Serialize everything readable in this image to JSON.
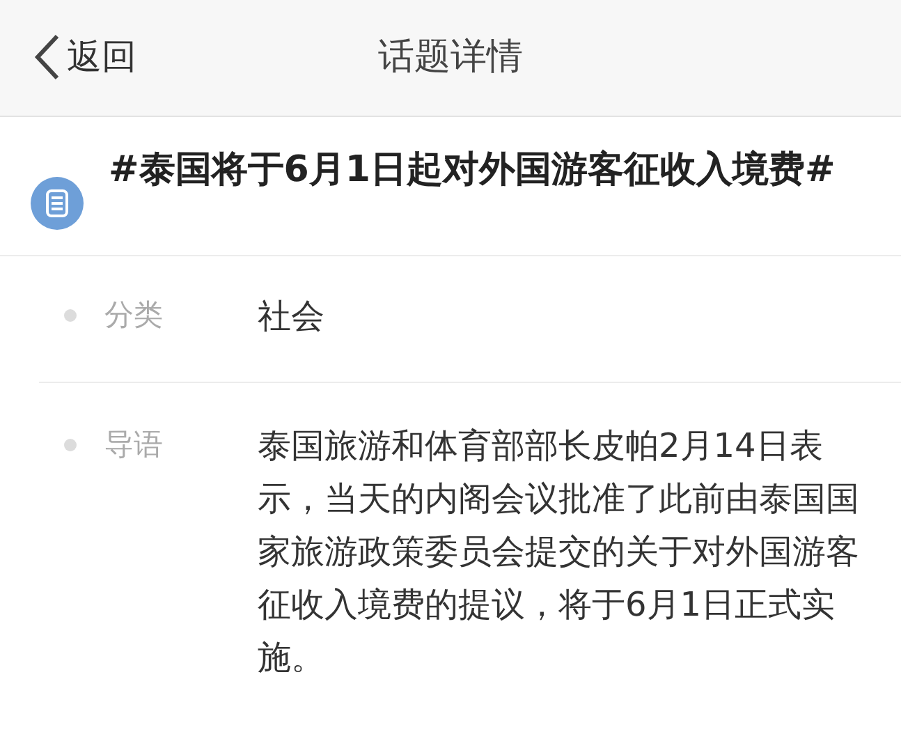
{
  "nav_bar": {
    "back": "返回",
    "title": "话题详情"
  },
  "topic": {
    "title": "#泰国将于6月1日起对外国游客征收入境费#"
  },
  "fields": [
    {
      "label": "分类",
      "value": "社会"
    },
    {
      "label": "导语",
      "value": "泰国旅游和体育部部长皮帕2月14日表示，当天的内阁会议批准了此前由泰国国家旅游政策委员会提交的关于对外国游客征收入境费的提议，将于6月1日正式实施。"
    }
  ]
}
